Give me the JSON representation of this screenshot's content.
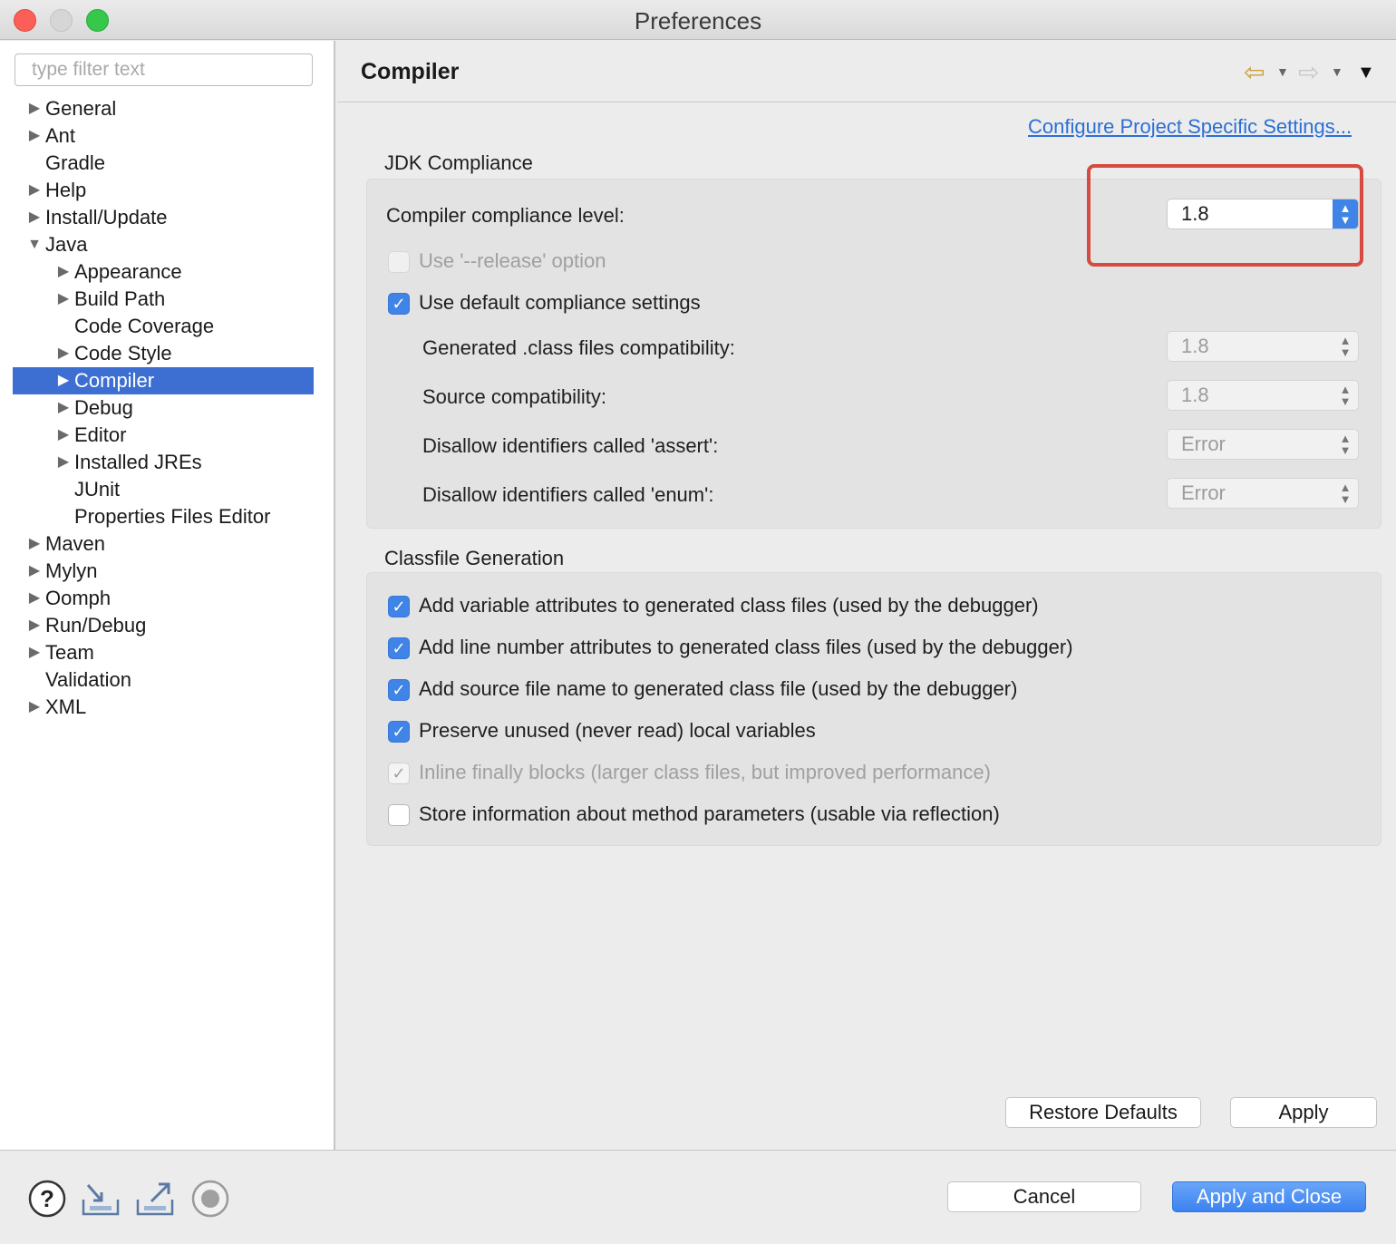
{
  "window": {
    "title": "Preferences"
  },
  "filter": {
    "placeholder": "type filter text"
  },
  "tree": [
    {
      "label": "General",
      "level": 0,
      "arrow": "right"
    },
    {
      "label": "Ant",
      "level": 0,
      "arrow": "right"
    },
    {
      "label": "Gradle",
      "level": 0,
      "arrow": "none"
    },
    {
      "label": "Help",
      "level": 0,
      "arrow": "right"
    },
    {
      "label": "Install/Update",
      "level": 0,
      "arrow": "right"
    },
    {
      "label": "Java",
      "level": 0,
      "arrow": "down"
    },
    {
      "label": "Appearance",
      "level": 1,
      "arrow": "right"
    },
    {
      "label": "Build Path",
      "level": 1,
      "arrow": "right"
    },
    {
      "label": "Code Coverage",
      "level": 1,
      "arrow": "none"
    },
    {
      "label": "Code Style",
      "level": 1,
      "arrow": "right"
    },
    {
      "label": "Compiler",
      "level": 1,
      "arrow": "right",
      "selected": true
    },
    {
      "label": "Debug",
      "level": 1,
      "arrow": "right"
    },
    {
      "label": "Editor",
      "level": 1,
      "arrow": "right"
    },
    {
      "label": "Installed JREs",
      "level": 1,
      "arrow": "right"
    },
    {
      "label": "JUnit",
      "level": 1,
      "arrow": "none"
    },
    {
      "label": "Properties Files Editor",
      "level": 1,
      "arrow": "none"
    },
    {
      "label": "Maven",
      "level": 0,
      "arrow": "right"
    },
    {
      "label": "Mylyn",
      "level": 0,
      "arrow": "right"
    },
    {
      "label": "Oomph",
      "level": 0,
      "arrow": "right"
    },
    {
      "label": "Run/Debug",
      "level": 0,
      "arrow": "right"
    },
    {
      "label": "Team",
      "level": 0,
      "arrow": "right"
    },
    {
      "label": "Validation",
      "level": 0,
      "arrow": "none"
    },
    {
      "label": "XML",
      "level": 0,
      "arrow": "right"
    }
  ],
  "page": {
    "title": "Compiler",
    "configure_link": "Configure Project Specific Settings...",
    "jdk": {
      "group_title": "JDK Compliance",
      "compliance_label": "Compiler compliance level:",
      "compliance_value": "1.8",
      "release_option": "Use '--release' option",
      "release_checked": false,
      "use_default": "Use default compliance settings",
      "use_default_checked": true,
      "generated_label": "Generated .class files compatibility:",
      "generated_value": "1.8",
      "source_label": "Source compatibility:",
      "source_value": "1.8",
      "assert_label": "Disallow identifiers called 'assert':",
      "assert_value": "Error",
      "enum_label": "Disallow identifiers called 'enum':",
      "enum_value": "Error"
    },
    "classfile": {
      "group_title": "Classfile Generation",
      "options": [
        {
          "label": "Add variable attributes to generated class files (used by the debugger)",
          "state": "checked"
        },
        {
          "label": "Add line number attributes to generated class files (used by the debugger)",
          "state": "checked"
        },
        {
          "label": "Add source file name to generated class file (used by the debugger)",
          "state": "checked"
        },
        {
          "label": "Preserve unused (never read) local variables",
          "state": "checked"
        },
        {
          "label": "Inline finally blocks (larger class files, but improved performance)",
          "state": "checked-disabled"
        },
        {
          "label": "Store information about method parameters (usable via reflection)",
          "state": "unchecked"
        }
      ]
    },
    "restore_defaults": "Restore Defaults",
    "apply": "Apply"
  },
  "footer": {
    "cancel": "Cancel",
    "apply_and_close": "Apply and Close",
    "icons": [
      "help-icon",
      "import-icon",
      "export-icon",
      "record-icon"
    ]
  },
  "colors": {
    "selection": "#3d6fd2",
    "accent": "#3f84e6",
    "highlight_box": "#d54b3f",
    "link": "#2c6fd6"
  }
}
